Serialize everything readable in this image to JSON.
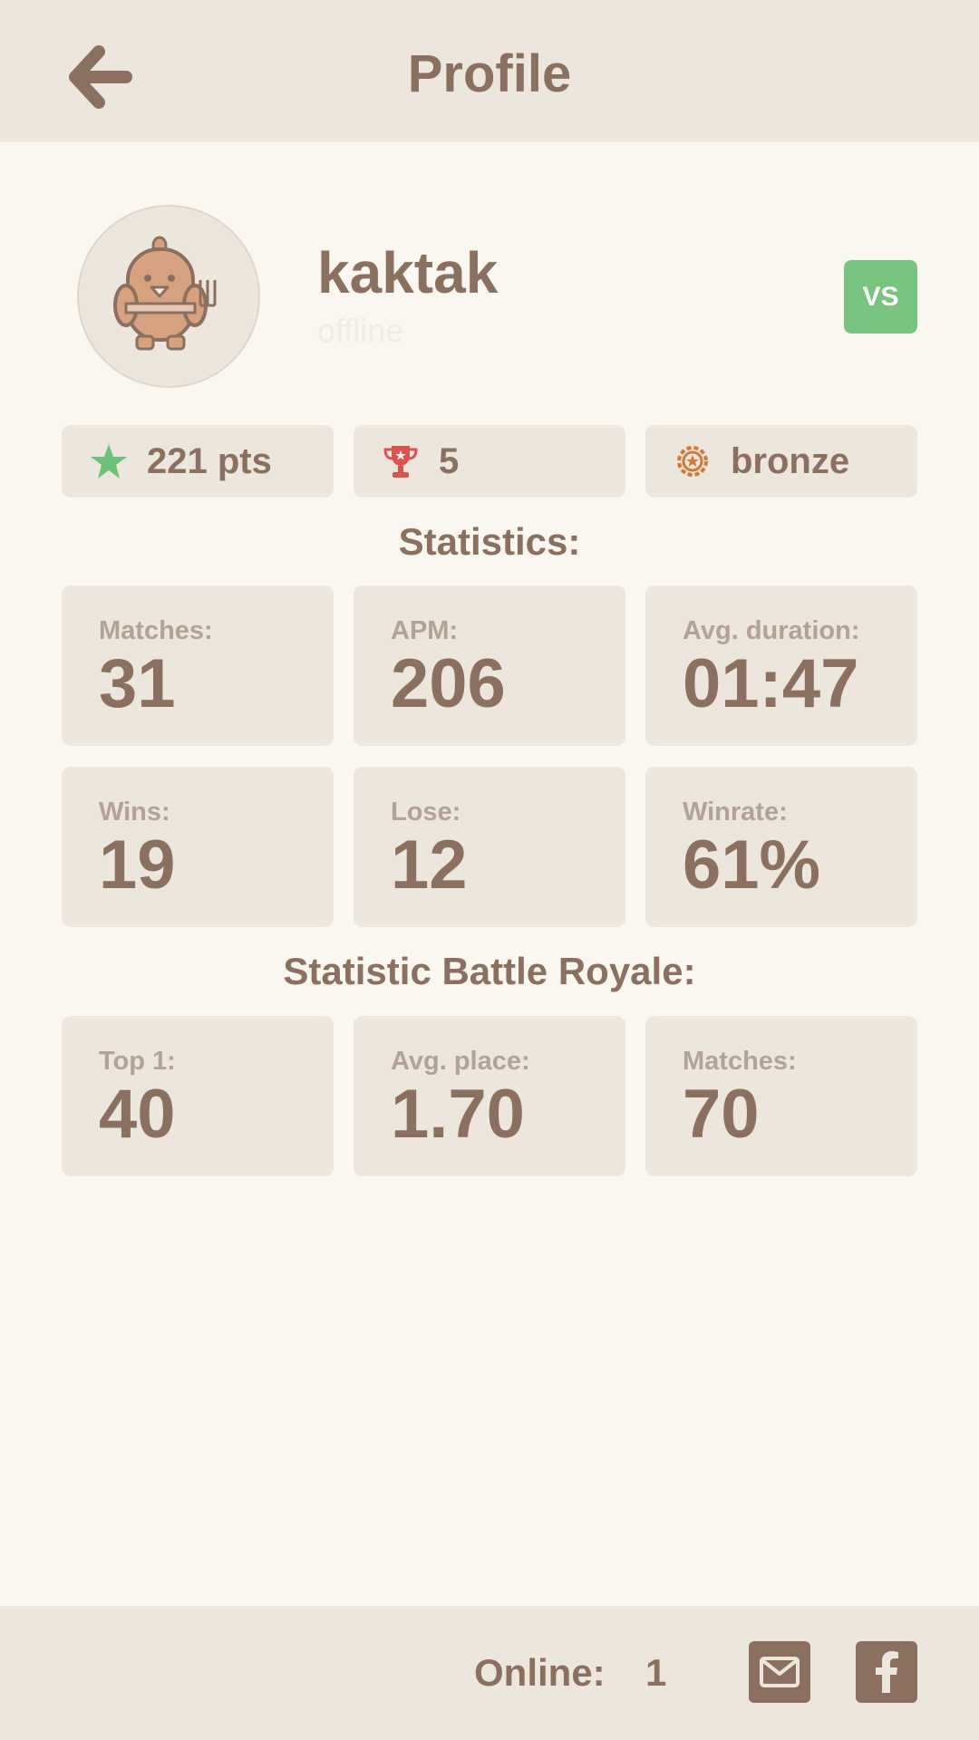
{
  "header": {
    "title": "Profile",
    "back_icon": "arrow-left-icon"
  },
  "profile": {
    "username": "kaktak",
    "status": "offline",
    "avatar_icon": "bird-avatar-icon",
    "vs_label": "VS"
  },
  "badges": [
    {
      "icon": "star-icon",
      "text": "221 pts",
      "color": "#6cc27a"
    },
    {
      "icon": "trophy-icon",
      "text": "5",
      "color": "#d9534f"
    },
    {
      "icon": "medal-icon",
      "text": "bronze",
      "color": "#d07a3a"
    }
  ],
  "statistics": {
    "title": "Statistics:",
    "cards": [
      {
        "label": "Matches:",
        "value": "31"
      },
      {
        "label": "APM:",
        "value": "206"
      },
      {
        "label": "Avg. duration:",
        "value": "01:47"
      },
      {
        "label": "Wins:",
        "value": "19"
      },
      {
        "label": "Lose:",
        "value": "12"
      },
      {
        "label": "Winrate:",
        "value": "61%"
      }
    ]
  },
  "battle_royale": {
    "title": "Statistic Battle Royale:",
    "cards": [
      {
        "label": "Top 1:",
        "value": "40"
      },
      {
        "label": "Avg. place:",
        "value": "1.70"
      },
      {
        "label": "Matches:",
        "value": "70"
      }
    ]
  },
  "footer": {
    "online_label": "Online:",
    "online_count": "1",
    "mail_icon": "mail-icon",
    "facebook_icon": "facebook-icon"
  },
  "colors": {
    "background": "#faf7f0",
    "panel": "#ede6dd",
    "text": "#8b7060",
    "label": "#b3a396",
    "vs_button": "#79c47f"
  }
}
